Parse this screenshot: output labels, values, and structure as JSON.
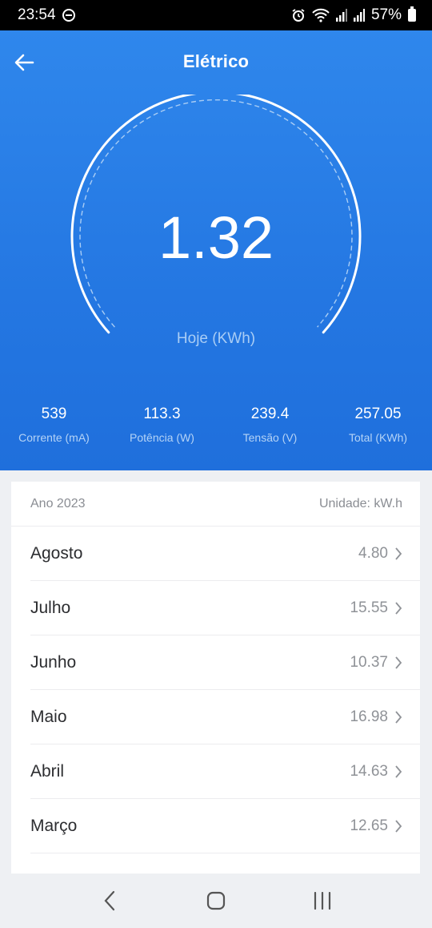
{
  "status_bar": {
    "time": "23:54",
    "battery": "57%"
  },
  "header": {
    "title": "Elétrico"
  },
  "gauge": {
    "value": "1.32",
    "label": "Hoje (KWh)"
  },
  "stats": [
    {
      "value": "539",
      "label": "Corrente (mA)"
    },
    {
      "value": "113.3",
      "label": "Potência (W)"
    },
    {
      "value": "239.4",
      "label": "Tensão (V)"
    },
    {
      "value": "257.05",
      "label": "Total (KWh)"
    }
  ],
  "list": {
    "year_label": "Ano 2023",
    "unit_label": "Unidade: kW.h",
    "rows": [
      {
        "month": "Agosto",
        "value": "4.80"
      },
      {
        "month": "Julho",
        "value": "15.55"
      },
      {
        "month": "Junho",
        "value": "10.37"
      },
      {
        "month": "Maio",
        "value": "16.98"
      },
      {
        "month": "Abril",
        "value": "14.63"
      },
      {
        "month": "Março",
        "value": "12.65"
      }
    ]
  },
  "colors": {
    "accent": "#2477e2",
    "background": "#eef0f3"
  },
  "icons": {
    "back": "arrow-left-icon",
    "chevron": "chevron-right-icon",
    "nav_back": "nav-back-icon",
    "nav_home": "nav-home-icon",
    "nav_recents": "nav-recents-icon"
  }
}
